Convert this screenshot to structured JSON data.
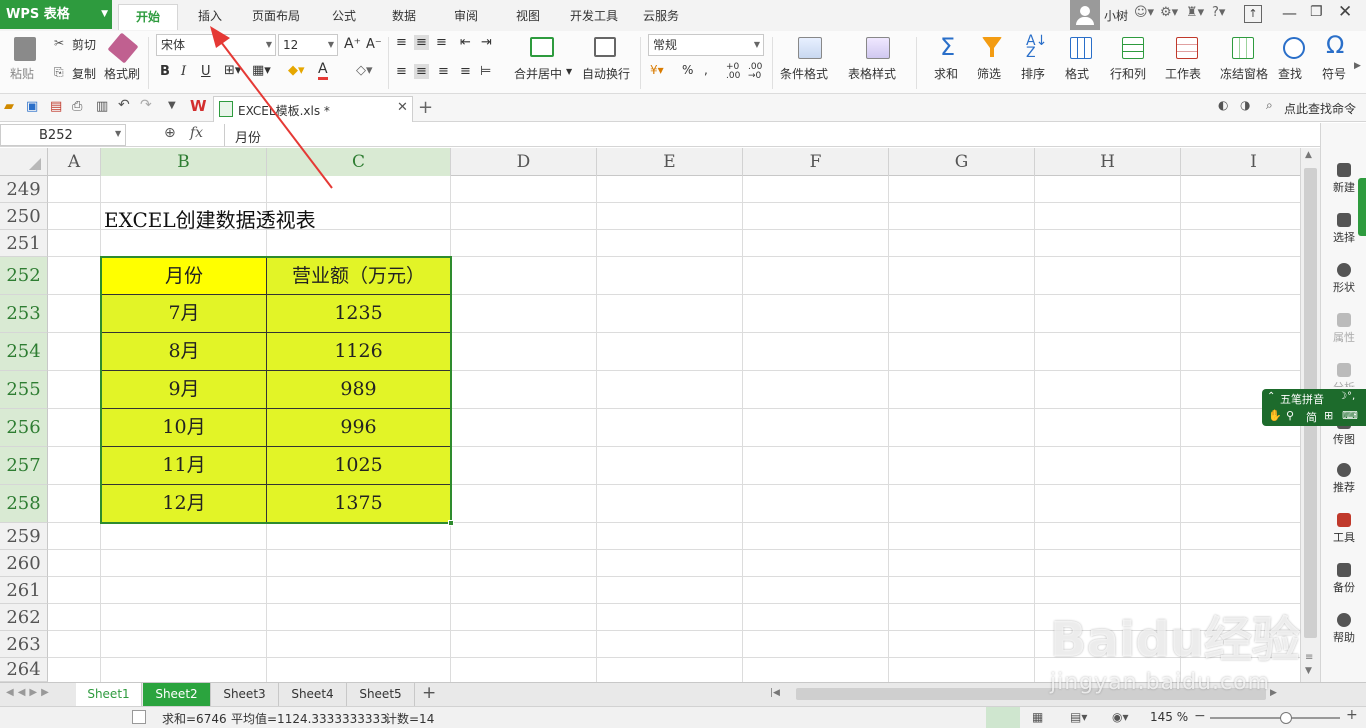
{
  "app": {
    "name": "WPS 表格",
    "user": "小树"
  },
  "menu_tabs": [
    "开始",
    "插入",
    "页面布局",
    "公式",
    "数据",
    "审阅",
    "视图",
    "开发工具",
    "云服务"
  ],
  "ribbon": {
    "paste": "粘贴",
    "cut": "剪切",
    "copy": "复制",
    "format_painter": "格式刷",
    "font_name": "宋体",
    "font_size": "12",
    "merge_center": "合并居中",
    "wrap_text": "自动换行",
    "number_format": "常规",
    "cond_format": "条件格式",
    "table_style": "表格样式",
    "sum": "求和",
    "filter": "筛选",
    "sort": "排序",
    "format": "格式",
    "row_col": "行和列",
    "worksheet": "工作表",
    "freeze": "冻结窗格",
    "find": "查找",
    "symbol": "符号"
  },
  "doc_tab": {
    "filename": "EXCEL模板.xls *"
  },
  "search_cmd": "点此查找命令",
  "formula_bar": {
    "cell_ref": "B252",
    "fx": "fx",
    "content": "月份"
  },
  "columns": [
    "A",
    "B",
    "C",
    "D",
    "E",
    "F",
    "G",
    "H",
    "I"
  ],
  "rows": [
    "249",
    "250",
    "251",
    "252",
    "253",
    "254",
    "255",
    "256",
    "257",
    "258",
    "259",
    "260",
    "261",
    "262",
    "263",
    "264"
  ],
  "sheet_title": "EXCEL创建数据透视表",
  "table": {
    "headers": [
      "月份",
      "营业额（万元）"
    ],
    "rows": [
      [
        "7月",
        "1235"
      ],
      [
        "8月",
        "1126"
      ],
      [
        "9月",
        "989"
      ],
      [
        "10月",
        "996"
      ],
      [
        "11月",
        "1025"
      ],
      [
        "12月",
        "1375"
      ]
    ]
  },
  "side_panel": [
    "新建",
    "选择",
    "形状",
    "属性",
    "分析",
    "传图",
    "推荐",
    "工具",
    "备份",
    "帮助"
  ],
  "ime": {
    "line1": "五笔拼音",
    "line2": "简"
  },
  "sheets": [
    "Sheet1",
    "Sheet2",
    "Sheet3",
    "Sheet4",
    "Sheet5"
  ],
  "status": {
    "sum": "求和=6746",
    "avg": "平均值=1124.3333333333",
    "count": "计数=14",
    "zoom": "145 %"
  },
  "watermark": "Baidu经验",
  "watermark_url": "jingyan.baidu.com",
  "colors": {
    "accent": "#2e9b3e",
    "header_fill": "#ffff00",
    "data_fill": "#e2f427",
    "arrow": "#e53935"
  }
}
